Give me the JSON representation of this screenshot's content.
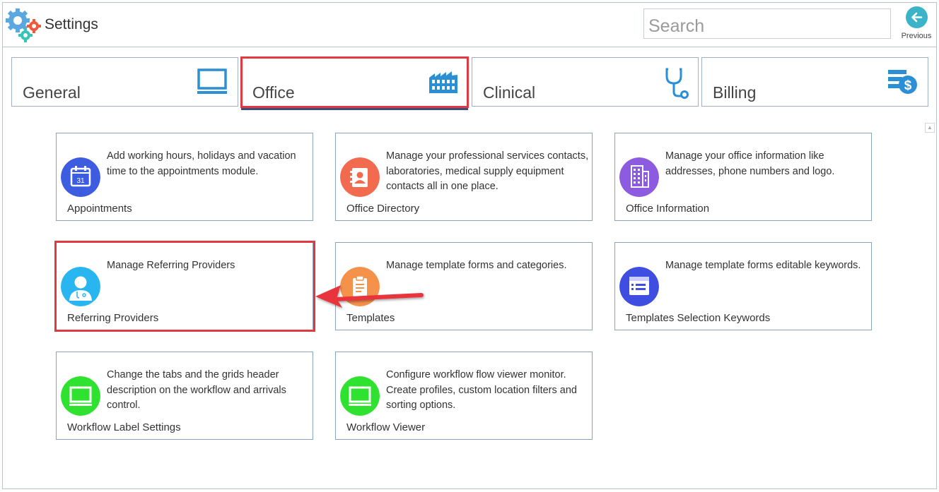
{
  "header": {
    "title": "Settings",
    "search_placeholder": "Search",
    "previous_label": "Previous"
  },
  "tabs": [
    {
      "label": "General",
      "icon": "monitor-icon"
    },
    {
      "label": "Office",
      "icon": "building-icon",
      "selected": true
    },
    {
      "label": "Clinical",
      "icon": "stethoscope-icon"
    },
    {
      "label": "Billing",
      "icon": "billing-icon"
    }
  ],
  "cards": [
    {
      "title": "Appointments",
      "description": "Add working hours, holidays and vacation time to the appointments module.",
      "icon": "calendar-icon",
      "icon_color": "#3d5ce0"
    },
    {
      "title": "Office Directory",
      "description": "Manage your professional services contacts, laboratories, medical supply equipment contacts all in one place.",
      "icon": "contact-book-icon",
      "icon_color": "#f36b4f"
    },
    {
      "title": "Office Information",
      "description": "Manage your office information like addresses, phone numbers and logo.",
      "icon": "office-building-icon",
      "icon_color": "#8c5be0"
    },
    {
      "title": "Referring Providers",
      "description": "Manage Referring Providers",
      "icon": "doctor-icon",
      "icon_color": "#29b6f0"
    },
    {
      "title": "Templates",
      "description": "Manage template forms and categories.",
      "icon": "clipboard-icon",
      "icon_color": "#f4914a"
    },
    {
      "title": "Templates Selection Keywords",
      "description": "Manage template forms editable keywords.",
      "icon": "form-list-icon",
      "icon_color": "#3d4ee0"
    },
    {
      "title": "Workflow Label Settings",
      "description": "Change the tabs and the grids header description on the workflow and arrivals control.",
      "icon": "monitor-icon",
      "icon_color": "#2fe22f"
    },
    {
      "title": "Workflow Viewer",
      "description": "Configure workflow flow viewer monitor. Create profiles, custom location filters and sorting options.",
      "icon": "monitor-icon",
      "icon_color": "#2fe22f"
    }
  ],
  "colors": {
    "accent_blue": "#2b8fd6",
    "highlight_red": "#e03a40",
    "selected_underline": "#3b4f7f"
  }
}
